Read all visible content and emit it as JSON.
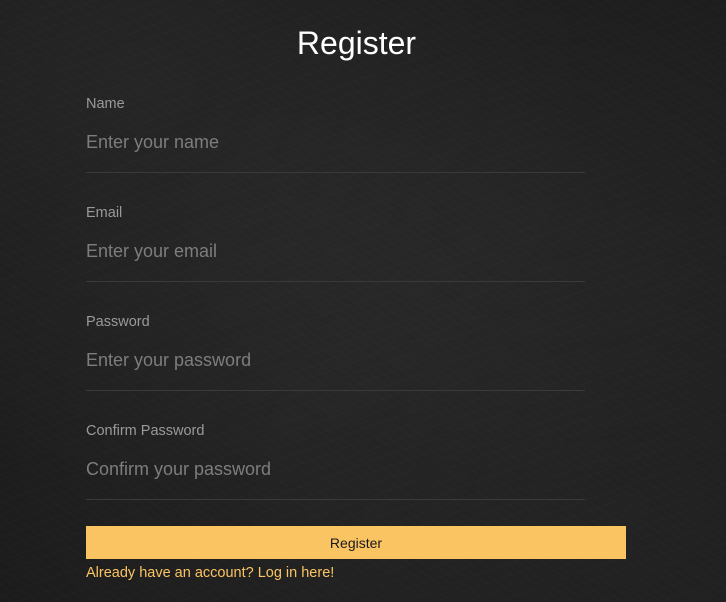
{
  "page": {
    "title": "Register"
  },
  "form": {
    "fields": [
      {
        "label": "Name",
        "placeholder": "Enter your name",
        "value": ""
      },
      {
        "label": "Email",
        "placeholder": "Enter your email",
        "value": ""
      },
      {
        "label": "Password",
        "placeholder": "Enter your password",
        "value": ""
      },
      {
        "label": "Confirm Password",
        "placeholder": "Confirm your password",
        "value": ""
      }
    ],
    "submit_label": "Register",
    "login_link": "Already have an account? Log in here!"
  },
  "colors": {
    "background": "#1c1c1c",
    "accent": "#fbc462",
    "label": "#9a9a9a",
    "placeholder": "#7d7d7d",
    "title": "#ffffff"
  }
}
